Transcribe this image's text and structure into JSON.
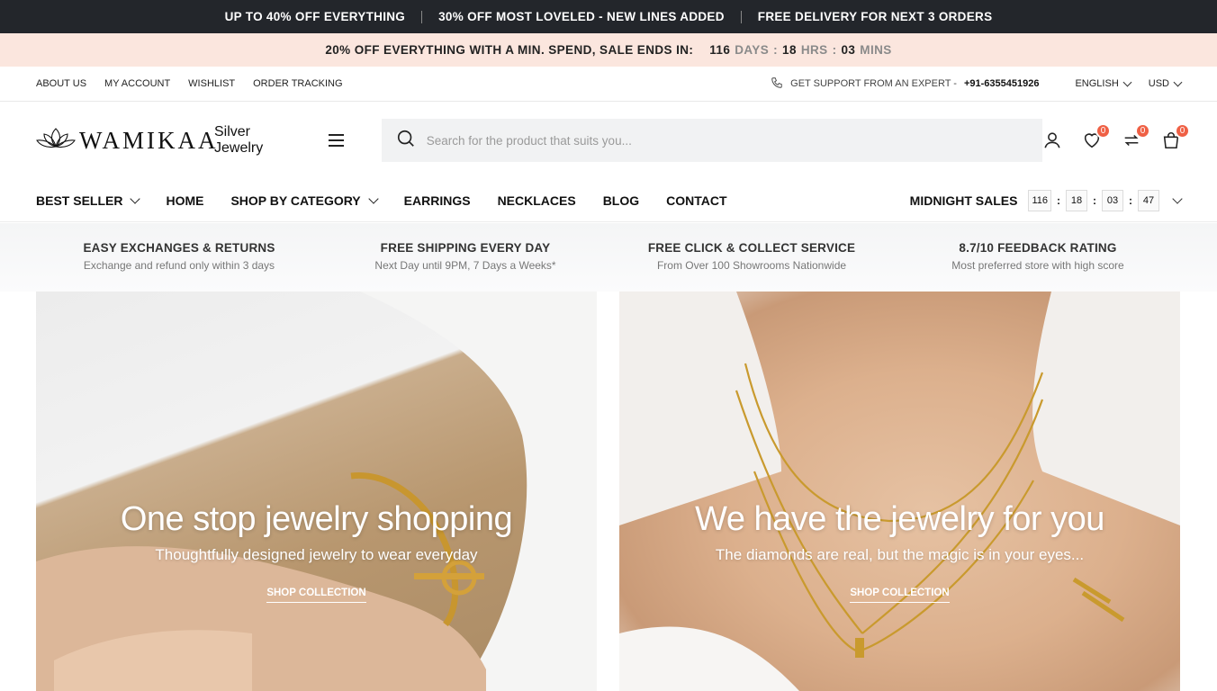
{
  "promo": {
    "items": [
      "UP TO 40% OFF EVERYTHING",
      "30% OFF MOST LOVELED - NEW LINES ADDED",
      "FREE DELIVERY FOR NEXT 3 ORDERS"
    ]
  },
  "sale_bar": {
    "text": "20% OFF EVERYTHING WITH A MIN. SPEND, SALE ENDS IN:",
    "days": "116",
    "days_label": "DAYS",
    "hrs": "18",
    "hrs_label": "HRS",
    "mins": "03",
    "mins_label": "MINS"
  },
  "utility": {
    "links": [
      "ABOUT US",
      "MY ACCOUNT",
      "WISHLIST",
      "ORDER TRACKING"
    ],
    "support_text": "GET SUPPORT FROM AN EXPERT -",
    "support_phone": "+91-6355451926",
    "language": "ENGLISH",
    "currency": "USD"
  },
  "header": {
    "logo_text": "WAMIKAA",
    "logo_sub": "Silver Jewelry",
    "search_placeholder": "Search for the product that suits you...",
    "wishlist_count": "0",
    "compare_count": "0",
    "cart_count": "0",
    "icons": [
      "user-icon",
      "heart-icon",
      "compare-icon",
      "bag-icon"
    ]
  },
  "nav": {
    "items": [
      "BEST SELLER",
      "HOME",
      "SHOP BY CATEGORY",
      "EARRINGS",
      "NECKLACES",
      "BLOG",
      "CONTACT"
    ],
    "midnight_label": "MIDNIGHT SALES",
    "timer": [
      "116",
      "18",
      "03",
      "47"
    ]
  },
  "features": [
    {
      "title": "EASY EXCHANGES & RETURNS",
      "sub": "Exchange and refund only within 3 days"
    },
    {
      "title": "FREE SHIPPING EVERY DAY",
      "sub": "Next Day until 9PM, 7 Days a Weeks*"
    },
    {
      "title": "FREE CLICK & COLLECT SERVICE",
      "sub": "From Over 100 Showrooms Nationwide"
    },
    {
      "title": "8.7/10 FEEDBACK RATING",
      "sub": "Most preferred store with high score"
    }
  ],
  "banners": [
    {
      "title": "One stop jewelry shopping",
      "sub": "Thoughtfully designed jewelry to wear everyday",
      "cta": "SHOP COLLECTION"
    },
    {
      "title": "We have the jewelry for you",
      "sub": "The diamonds are real, but the magic is in your eyes...",
      "cta": "SHOP COLLECTION"
    }
  ],
  "colors": {
    "topbar": "#23262b",
    "salebar": "#fbe6de",
    "badge": "#ef6045"
  }
}
